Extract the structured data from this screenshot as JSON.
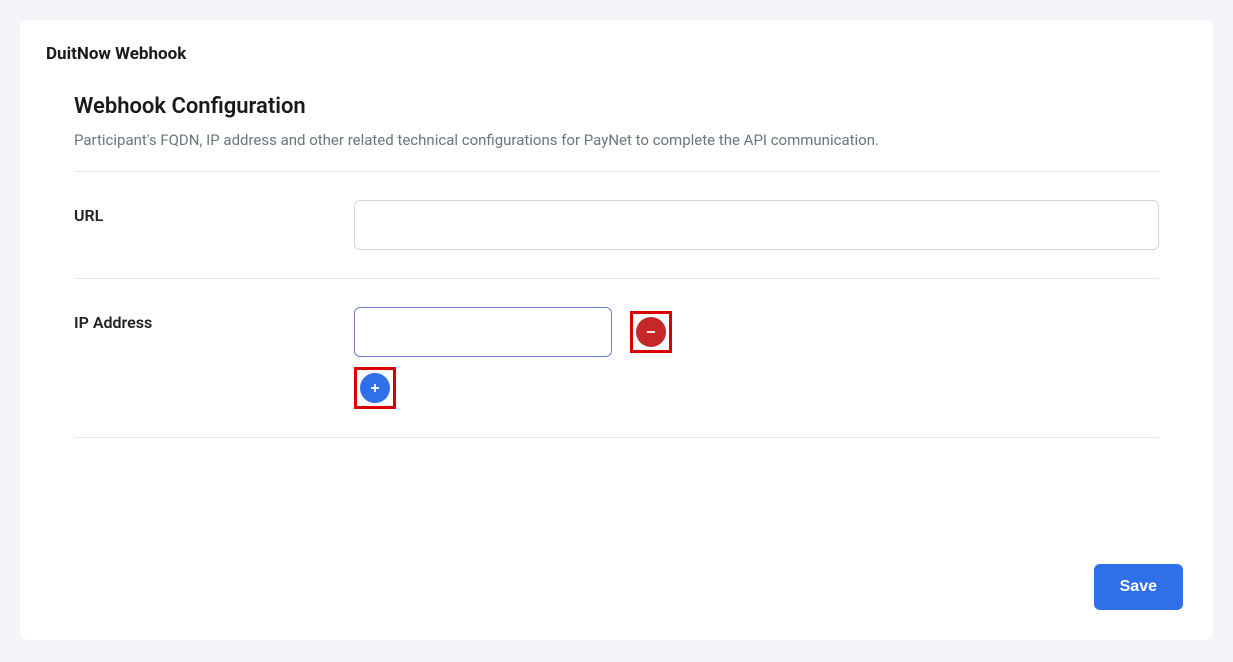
{
  "card": {
    "title": "DuitNow Webhook"
  },
  "section": {
    "heading": "Webhook Configuration",
    "description": "Participant's FQDN, IP address and other related technical configurations for PayNet to complete the API communication."
  },
  "form": {
    "url_label": "URL",
    "url_value": "",
    "ip_label": "IP Address",
    "ip_value": ""
  },
  "buttons": {
    "save": "Save"
  },
  "icons": {
    "minus": "minus",
    "plus": "plus"
  }
}
